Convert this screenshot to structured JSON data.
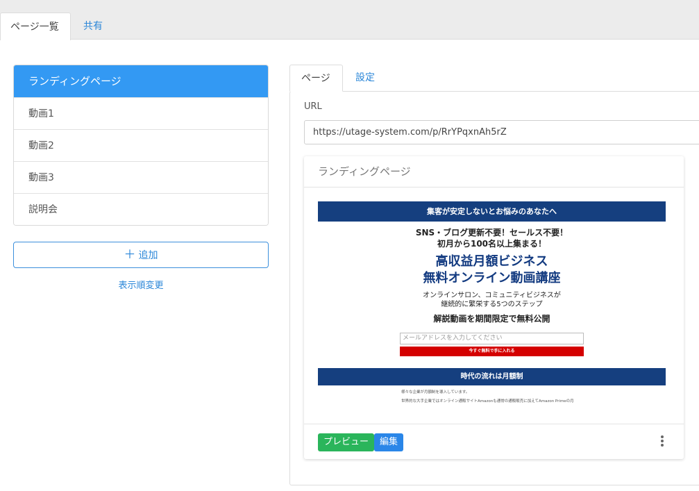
{
  "top_tabs": [
    {
      "label": "ページ一覧",
      "active": true
    },
    {
      "label": "共有",
      "active": false
    }
  ],
  "page_list": {
    "items": [
      "ランディングページ",
      "動画1",
      "動画2",
      "動画3",
      "説明会"
    ],
    "active_index": 0
  },
  "add_button": {
    "icon": "plus-icon",
    "label": "追加"
  },
  "reorder_link": "表示順変更",
  "right_tabs": [
    {
      "label": "ページ",
      "active": true
    },
    {
      "label": "設定",
      "active": false
    }
  ],
  "url": {
    "label": "URL",
    "value": "https://utage-system.com/p/RrYPqxnAh5rZ"
  },
  "card": {
    "title": "ランディングページ",
    "preview_label": "プレビュー",
    "edit_label": "編集",
    "menu_icon": "kebab-menu-icon"
  },
  "thumbnail": {
    "band_top": "集客が安定しないとお悩みのあなたへ",
    "line1": "SNS・ブログ更新不要！セールス不要！",
    "line2": "初月から100名以上集まる！",
    "headline1": "高収益月額ビジネス",
    "headline2": "無料オンライン動画講座",
    "sub1": "オンラインサロン、コミュニティビジネスが",
    "sub2": "継続的に繁栄する5つのステップ",
    "cta_text": "解説動画を期間限定で無料公開",
    "email_placeholder": "メールアドレスを入力してください",
    "cta_button": "今すぐ無料で手に入れる",
    "band_bottom": "時代の流れは月額制",
    "small1": "様々な企業が月額制を導入しています。",
    "small2": "世界的な大手企業ではオンライン通販サイトAmazonも通常の通販販売に加えてAmazon Primeの月"
  },
  "colors": {
    "accent": "#3399f3",
    "link": "#2a86d8",
    "preview_green": "#2ab55b",
    "edit_blue": "#2a86e8",
    "banner_navy": "#153f7f",
    "cta_red": "#d40000"
  }
}
